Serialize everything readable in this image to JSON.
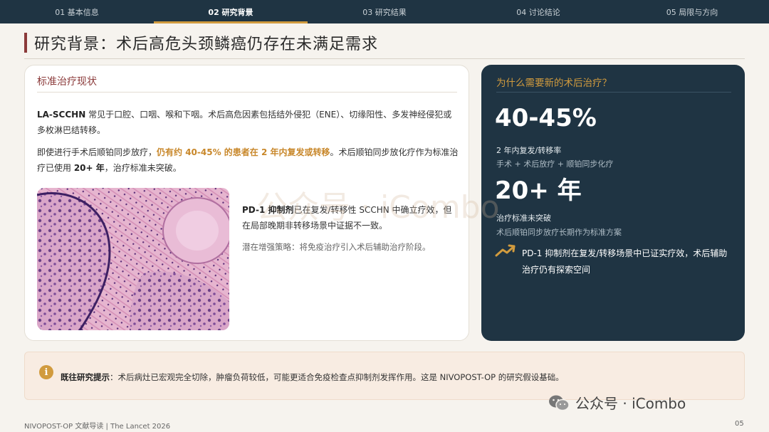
{
  "nav": {
    "tabs": [
      {
        "label": "01 基本信息",
        "active": false
      },
      {
        "label": "02 研究背景",
        "active": true
      },
      {
        "label": "03 研究结果",
        "active": false
      },
      {
        "label": "04 讨论结论",
        "active": false
      },
      {
        "label": "05 局限与方向",
        "active": false
      }
    ]
  },
  "page_title": "研究背景：术后高危头颈鳞癌仍存在未满足需求",
  "left_card": {
    "heading": "标准治疗现状",
    "p1_bold": "LA-SCCHN",
    "p1_rest": " 常见于口腔、口咽、喉和下咽。术后高危因素包括结外侵犯（ENE）、切缘阳性、多发神经侵犯或多枚淋巴结转移。",
    "p2_a": "即使进行手术后顺铂同步放疗，",
    "p2_highlight": "仍有约 40-45% 的患者在 2 年内复发或转移",
    "p2_b": "。术后顺铂同步放化疗作为标准治疗已使用 ",
    "p2_bold": "20+ 年",
    "p2_c": "，治疗标准未突破。",
    "image_bold": "PD-1 抑制剂",
    "image_text": "已在复发/转移性 SCCHN 中确立疗效，但在局部晚期非转移场景中证据不一致。",
    "image_note": "潜在增强策略：将免疫治疗引入术后辅助治疗阶段。"
  },
  "right_card": {
    "heading": "为什么需要新的术后治疗？",
    "stat1": "40-45%",
    "stat1_label": "2 年内复发/转移率",
    "stat1_sub": "手术 + 术后放疗 + 顺铂同步化疗",
    "stat2": "20+ 年",
    "stat2_label": "治疗标准未突破",
    "stat2_sub": "术后顺铂同步放疗长期作为标准方案",
    "note": "PD-1 抑制剂在复发/转移场景中已证实疗效，术后辅助治疗仍有探索空间",
    "icon": "trend-up-icon"
  },
  "callout": {
    "icon": "info-icon",
    "bold": "既往研究提示",
    "text": "：术后病灶已宏观完全切除，肿瘤负荷较低，可能更适合免疫检查点抑制剂发挥作用。这是 NIVOPOST-OP 的研究假设基础。"
  },
  "footer": {
    "left": "NIVOPOST-OP 文献导读 | The Lancet 2026",
    "page": "05"
  },
  "watermark": {
    "big": "公众号 · iCombo",
    "corner": "公众号 · iCombo"
  },
  "colors": {
    "navy": "#1f3443",
    "gold": "#d19b3e",
    "maroon": "#8b3a3a",
    "background": "#f6f3ee"
  }
}
